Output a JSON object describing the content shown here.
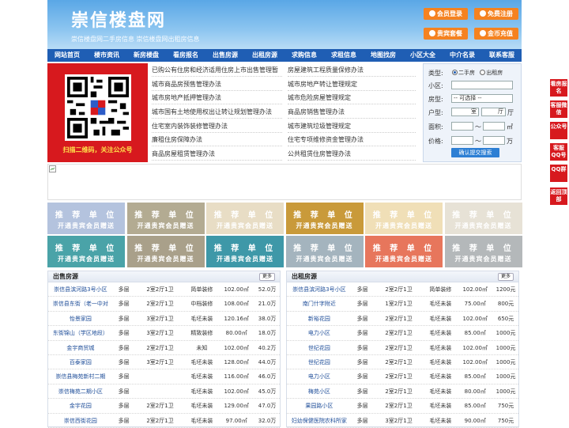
{
  "header": {
    "logo": "崇信楼盘网",
    "subtitle": "崇信楼盘网二手房信息   崇信楼盘网出租房信息",
    "buttons": [
      "会员登录",
      "免费注册",
      "贵宾套餐",
      "金币充值"
    ]
  },
  "nav": [
    "网站首页",
    "楼市资讯",
    "新房楼盘",
    "看房报名",
    "出售房源",
    "出租房源",
    "求购信息",
    "求租信息",
    "地图找房",
    "小区大全",
    "中介名录",
    "联系客服"
  ],
  "qr": {
    "caption": "扫描二维码，关注公众号"
  },
  "links": {
    "left": [
      "已购公有住房和经济适用住房上市出售管理暂",
      "城市商品房预售管理办法",
      "城市房地产抵押管理办法",
      "城市国有土地使用权出让转让规划管理办法",
      "住宅室内装饰装修管理办法",
      "廉租住房保障办法",
      "商品房屋租赁管理办法"
    ],
    "right": [
      "房屋建筑工程质量保修办法",
      "城市房地产转让管理规定",
      "城市危险房屋管理规定",
      "商品房销售管理办法",
      "城市建筑垃圾管理规定",
      "住宅专项维修资金管理办法",
      "公共租赁住房管理办法"
    ]
  },
  "search": {
    "type_label": "类型:",
    "type_options": [
      "二手房",
      "出租房"
    ],
    "community_label": "小区:",
    "house_type_label": "房型:",
    "house_type_value": "-- 可选择 --",
    "layout_label": "户型:",
    "room_value": "室",
    "hall_value": "厅",
    "area_label": "面积:",
    "area_sep": "〜",
    "area_unit": "㎡",
    "price_label": "价格:",
    "price_sep": "〜",
    "price_unit": "万",
    "submit": "确认提交搜索"
  },
  "recommend": {
    "title": "推 荐 单 位",
    "subtitle": "开通贵宾会员赠送",
    "colors": [
      "#b4c3de",
      "#b3ab92",
      "#e8ddc5",
      "#c99a3a",
      "#f0dfb7",
      "#e7e2d6",
      "#4aa3a8",
      "#a9a08a",
      "#3e98a8",
      "#a4b4be",
      "#e7765c",
      "#b4b8ba"
    ]
  },
  "sale": {
    "title": "出售房源",
    "more": "更多",
    "rows": [
      [
        "崇信县滨河路3号小区",
        "多层",
        "2室2厅1卫",
        "简单装修",
        "102.00㎡",
        "52.0万"
      ],
      [
        "崇信县东街（老一中对",
        "多层",
        "2室2厅1卫",
        "中档装修",
        "108.00㎡",
        "21.0万"
      ],
      [
        "怡景家园",
        "多层",
        "3室2厅1卫",
        "毛坯未装",
        "120.16㎡",
        "38.0万"
      ],
      [
        "东街锦山（学区地段）",
        "多层",
        "3室2厅1卫",
        "精致装修",
        "80.00㎡",
        "18.0万"
      ],
      [
        "金宇商贸城",
        "多层",
        "2室2厅1卫",
        "未知",
        "102.00㎡",
        "40.2万"
      ],
      [
        "百泰家园",
        "多层",
        "3室2厅1卫",
        "毛坯未装",
        "128.00㎡",
        "44.0万"
      ],
      [
        "崇信县梅苑新村二期",
        "多层",
        "",
        "毛坯未装",
        "116.00㎡",
        "46.0万"
      ],
      [
        "崇信梅苑二期小区",
        "多层",
        "",
        "毛坯未装",
        "102.00㎡",
        "45.0万"
      ],
      [
        "金宇花园",
        "多层",
        "2室2厅1卫",
        "毛坯未装",
        "129.00㎡",
        "47.0万"
      ],
      [
        "崇信西街花园",
        "多层",
        "2室2厅1卫",
        "毛坯未装",
        "97.00㎡",
        "32.0万"
      ]
    ]
  },
  "rent": {
    "title": "出租房源",
    "more": "更多",
    "rows": [
      [
        "崇信县滨河路3号小区",
        "多层",
        "2室2厅1卫",
        "简单装修",
        "102.00㎡",
        "1200元"
      ],
      [
        "南门什字附近",
        "多层",
        "1室2厅1卫",
        "毛坯未装",
        "75.00㎡",
        "800元"
      ],
      [
        "新裕花园",
        "多层",
        "2室2厅1卫",
        "毛坯未装",
        "102.00㎡",
        "650元"
      ],
      [
        "电力小区",
        "多层",
        "2室2厅1卫",
        "毛坯未装",
        "85.00㎡",
        "1000元"
      ],
      [
        "世纪花园",
        "多层",
        "2室2厅1卫",
        "毛坯未装",
        "102.00㎡",
        "1000元"
      ],
      [
        "世纪花园",
        "多层",
        "2室2厅1卫",
        "毛坯未装",
        "102.00㎡",
        "1000元"
      ],
      [
        "电力小区",
        "多层",
        "2室2厅1卫",
        "毛坯未装",
        "85.00㎡",
        "1000元"
      ],
      [
        "梅苑小区",
        "多层",
        "2室2厅1卫",
        "毛坯未装",
        "80.00㎡",
        "1000元"
      ],
      [
        "果园路小区",
        "多层",
        "2室2厅1卫",
        "毛坯未装",
        "85.00㎡",
        "750元"
      ],
      [
        "妇幼保健医院农科所家",
        "多层",
        "3室2厅1卫",
        "毛坯未装",
        "90.00㎡",
        "750元"
      ]
    ]
  },
  "sidebar": [
    "看房报名",
    "客服微信",
    "公众号",
    "客服QQ号",
    "QQ群",
    "返回顶部"
  ]
}
